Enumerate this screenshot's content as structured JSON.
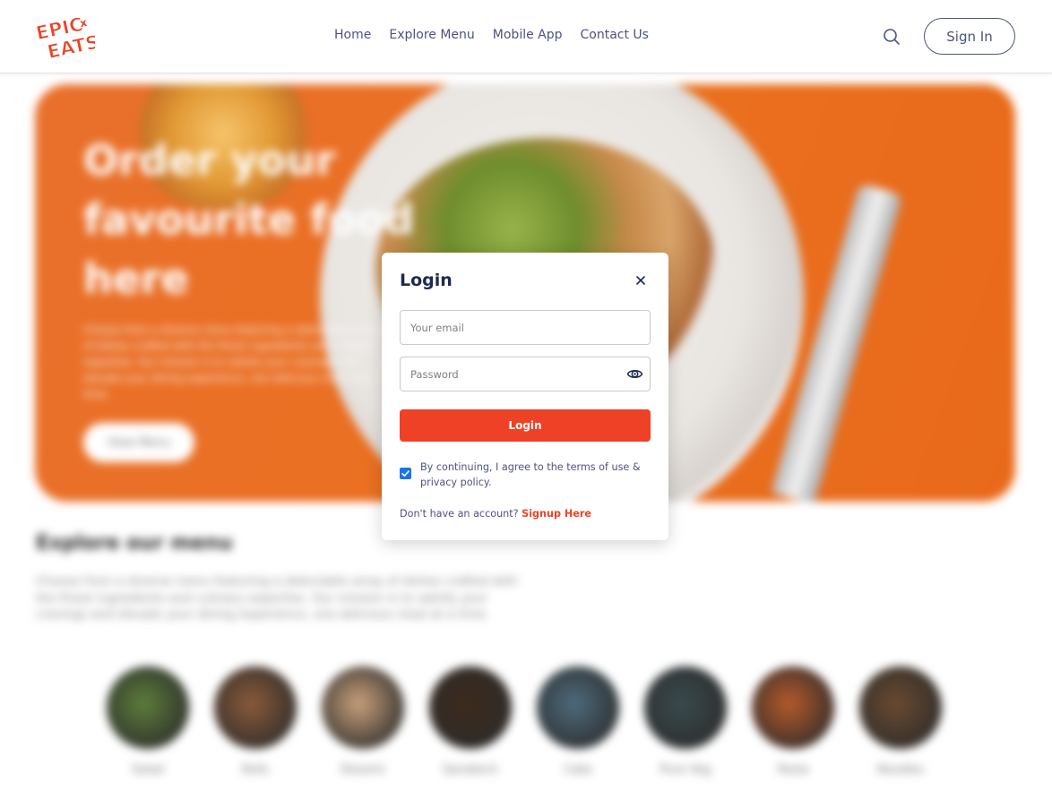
{
  "brand": {
    "logo_line1": "EPIC",
    "logo_line2": "EATS",
    "logo_mark": "x",
    "accent": "#ef4126"
  },
  "nav": {
    "links": [
      "Home",
      "Explore Menu",
      "Mobile App",
      "Contact Us"
    ],
    "signin_label": "Sign In",
    "search_icon": "search-icon"
  },
  "hero": {
    "title": "Order your favourite food here",
    "text": "Choose from a diverse menu featuring a delectable array of dishes crafted with the finest ingredients and culinary expertise. Our mission is to satisfy your cravings and elevate your dining experience, one delicious meal at a time.",
    "button": "View Menu"
  },
  "explore": {
    "title": "Explore our menu",
    "text": "Choose from a diverse menu featuring a delectable array of dishes crafted with the finest ingredients and culinary expertise. Our mission is to satisfy your cravings and elevate your dining experience, one delicious meal at a time.",
    "items": [
      {
        "label": "Salad",
        "color": "#5d7d3b"
      },
      {
        "label": "Rolls",
        "color": "#8a5a3a"
      },
      {
        "label": "Deserts",
        "color": "#c8a07a"
      },
      {
        "label": "Sandwich",
        "color": "#3d2a1c"
      },
      {
        "label": "Cake",
        "color": "#4e6b7c"
      },
      {
        "label": "Pure Veg",
        "color": "#3a4a4e"
      },
      {
        "label": "Pasta",
        "color": "#b55a2a"
      },
      {
        "label": "Noodles",
        "color": "#6a4a30"
      }
    ]
  },
  "login": {
    "title": "Login",
    "email_placeholder": "Your email",
    "password_placeholder": "Password",
    "submit": "Login",
    "terms": "By continuing, I agree to the terms of use & privacy policy.",
    "terms_checked": true,
    "signup_prompt": "Don't have an account?",
    "signup_link": "Signup Here"
  }
}
